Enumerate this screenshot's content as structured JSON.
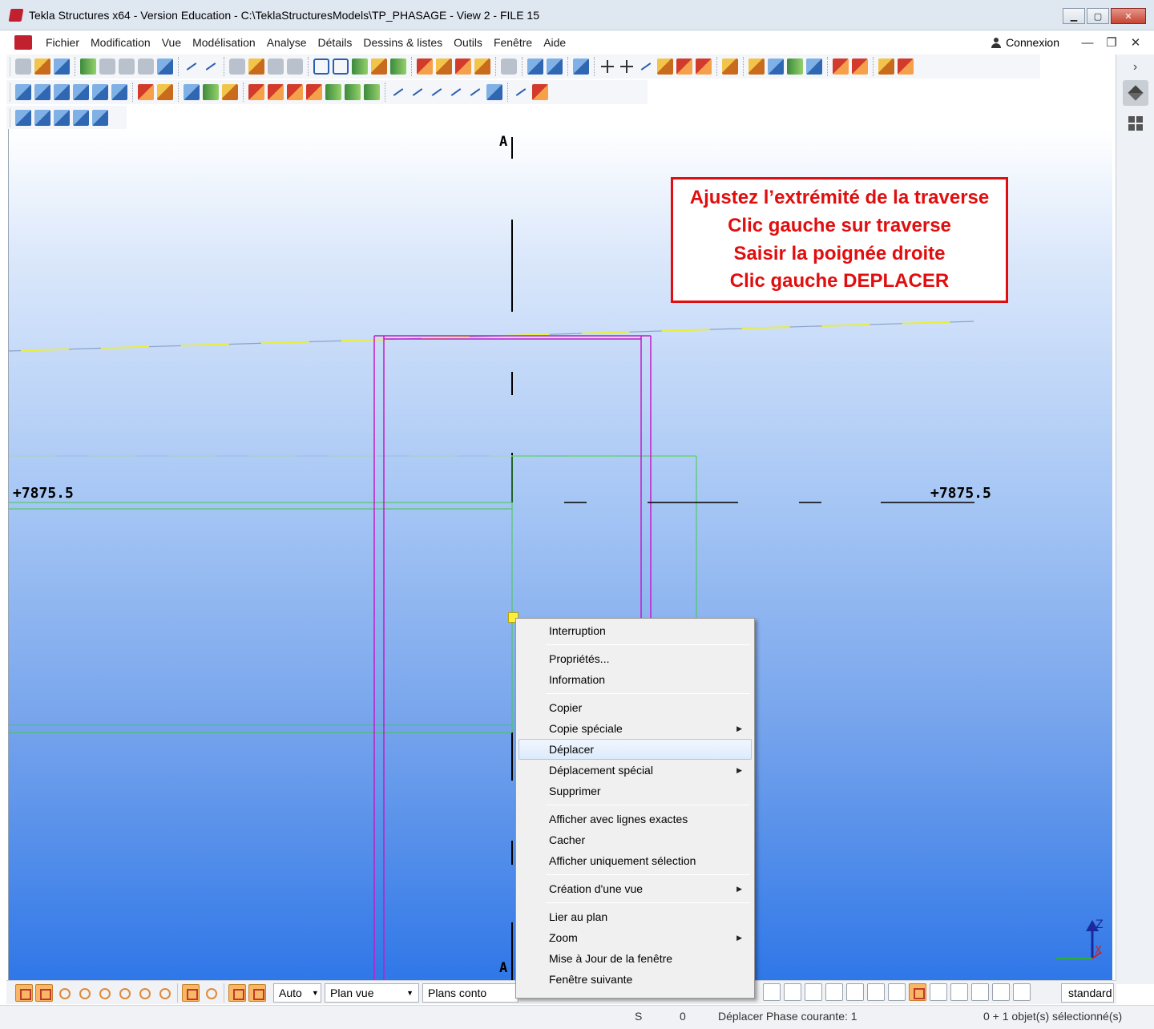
{
  "window": {
    "title": "Tekla Structures x64 - Version Education - C:\\TeklaStructuresModels\\TP_PHASAGE  - View 2 - FILE 15"
  },
  "menubar": {
    "items": [
      "Fichier",
      "Modification",
      "Vue",
      "Modélisation",
      "Analyse",
      "Détails",
      "Dessins & listes",
      "Outils",
      "Fenêtre",
      "Aide"
    ],
    "login_label": "Connexion"
  },
  "viewport": {
    "grid_label_top": "A",
    "grid_label_bottom": "A",
    "elevation_left": "+7875.5",
    "elevation_right": "+7875.5",
    "axis_z": "Z",
    "axis_x": "X"
  },
  "callout": {
    "lines": [
      "Ajustez l’extrémité de la traverse",
      "Clic gauche sur traverse",
      "Saisir la poignée droite",
      "Clic gauche DEPLACER"
    ],
    "color": "#e00e0e"
  },
  "context_menu": {
    "groups": [
      [
        {
          "label": "Interruption"
        }
      ],
      [
        {
          "label": "Propriétés..."
        },
        {
          "label": "Information"
        }
      ],
      [
        {
          "label": "Copier"
        },
        {
          "label": "Copie spéciale",
          "submenu": true
        },
        {
          "label": "Déplacer",
          "highlighted": true
        },
        {
          "label": "Déplacement spécial",
          "submenu": true
        },
        {
          "label": "Supprimer"
        }
      ],
      [
        {
          "label": "Afficher avec lignes exactes"
        },
        {
          "label": "Cacher"
        },
        {
          "label": "Afficher uniquement sélection"
        }
      ],
      [
        {
          "label": "Création d'une vue",
          "submenu": true
        }
      ],
      [
        {
          "label": "Lier au plan"
        },
        {
          "label": "Zoom",
          "submenu": true
        },
        {
          "label": "Mise à Jour de la fenêtre"
        },
        {
          "label": "Fenêtre suivante"
        }
      ]
    ]
  },
  "bottom_toolbar": {
    "snap_mode": "Auto",
    "plane": "Plan vue",
    "plane_type": "Plans conto",
    "style": "standard"
  },
  "status_bar": {
    "s_label": "S",
    "count": "0",
    "message": "Déplacer Phase courante: 1",
    "selection": "0 + 1 objet(s) sélectionné(s)"
  }
}
